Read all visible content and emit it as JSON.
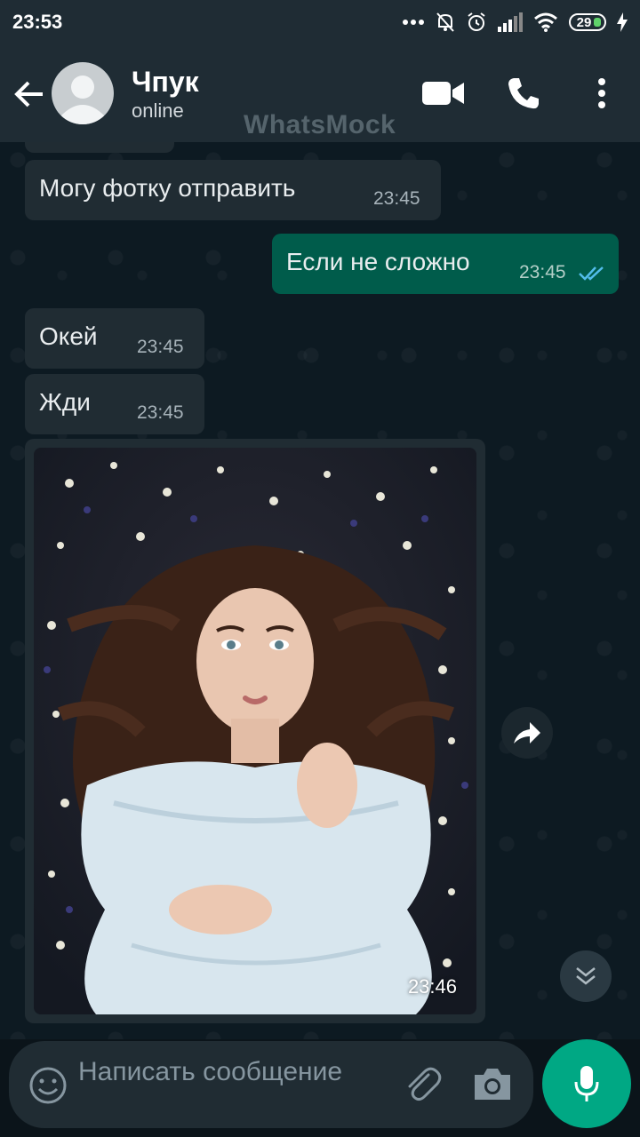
{
  "status_bar": {
    "time": "23:53",
    "battery": "29"
  },
  "header": {
    "contact_name": "Чпук",
    "contact_status": "online",
    "watermark": "WhatsMock"
  },
  "messages": [
    {
      "direction": "in",
      "text": "Могу фотку отправить",
      "time": "23:45"
    },
    {
      "direction": "out",
      "text": "Если не сложно",
      "time": "23:45",
      "status": "read"
    },
    {
      "direction": "in",
      "text": "Окей",
      "time": "23:45"
    },
    {
      "direction": "in",
      "text": "Жди",
      "time": "23:45"
    },
    {
      "direction": "in",
      "type": "photo",
      "time": "23:46"
    }
  ],
  "composer": {
    "placeholder": "Написать сообщение"
  },
  "colors": {
    "header_bg": "#1f2c34",
    "incoming_bubble": "#202c33",
    "outgoing_bubble": "#005c4b",
    "accent": "#00a884",
    "read_ticks": "#53bdeb"
  },
  "icons": {
    "back": "arrow-left",
    "video": "video-camera",
    "call": "phone",
    "menu": "more-vertical",
    "emoji": "smiley",
    "attach": "paperclip",
    "camera": "camera",
    "mic": "microphone",
    "forward": "share-arrow",
    "scroll": "chevron-double-down"
  }
}
